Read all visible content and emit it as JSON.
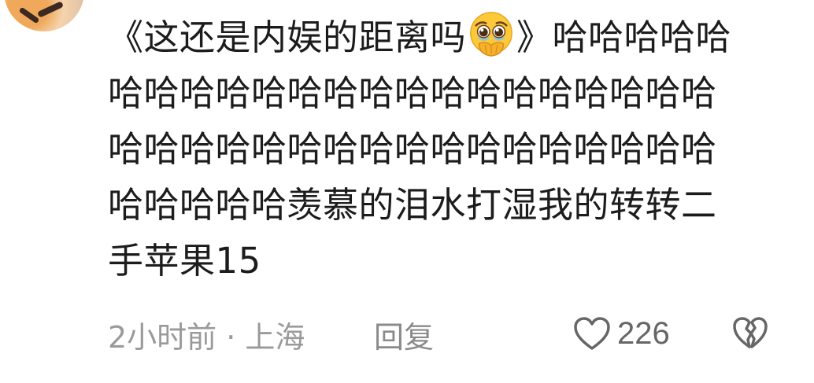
{
  "comment": {
    "text_before_emoji": "《这还是内娱的距离吗",
    "emoji": "holding-back-tears-emoji",
    "text_after_emoji": "》哈哈哈哈哈哈哈哈哈哈哈哈哈哈哈哈哈哈哈哈哈哈哈哈哈哈哈哈哈哈哈哈哈哈哈哈哈哈哈哈哈哈哈哈羡慕的泪水打湿我的转转二手苹果15"
  },
  "meta": {
    "time_location": "2小时前 · 上海",
    "reply_label": "回复"
  },
  "actions": {
    "like_count": "226",
    "like_icon": "heart-outline-icon",
    "dislike_icon": "broken-heart-icon"
  },
  "colors": {
    "text": "#1c1c1c",
    "meta": "#9a9a9a",
    "icon": "#666666"
  }
}
